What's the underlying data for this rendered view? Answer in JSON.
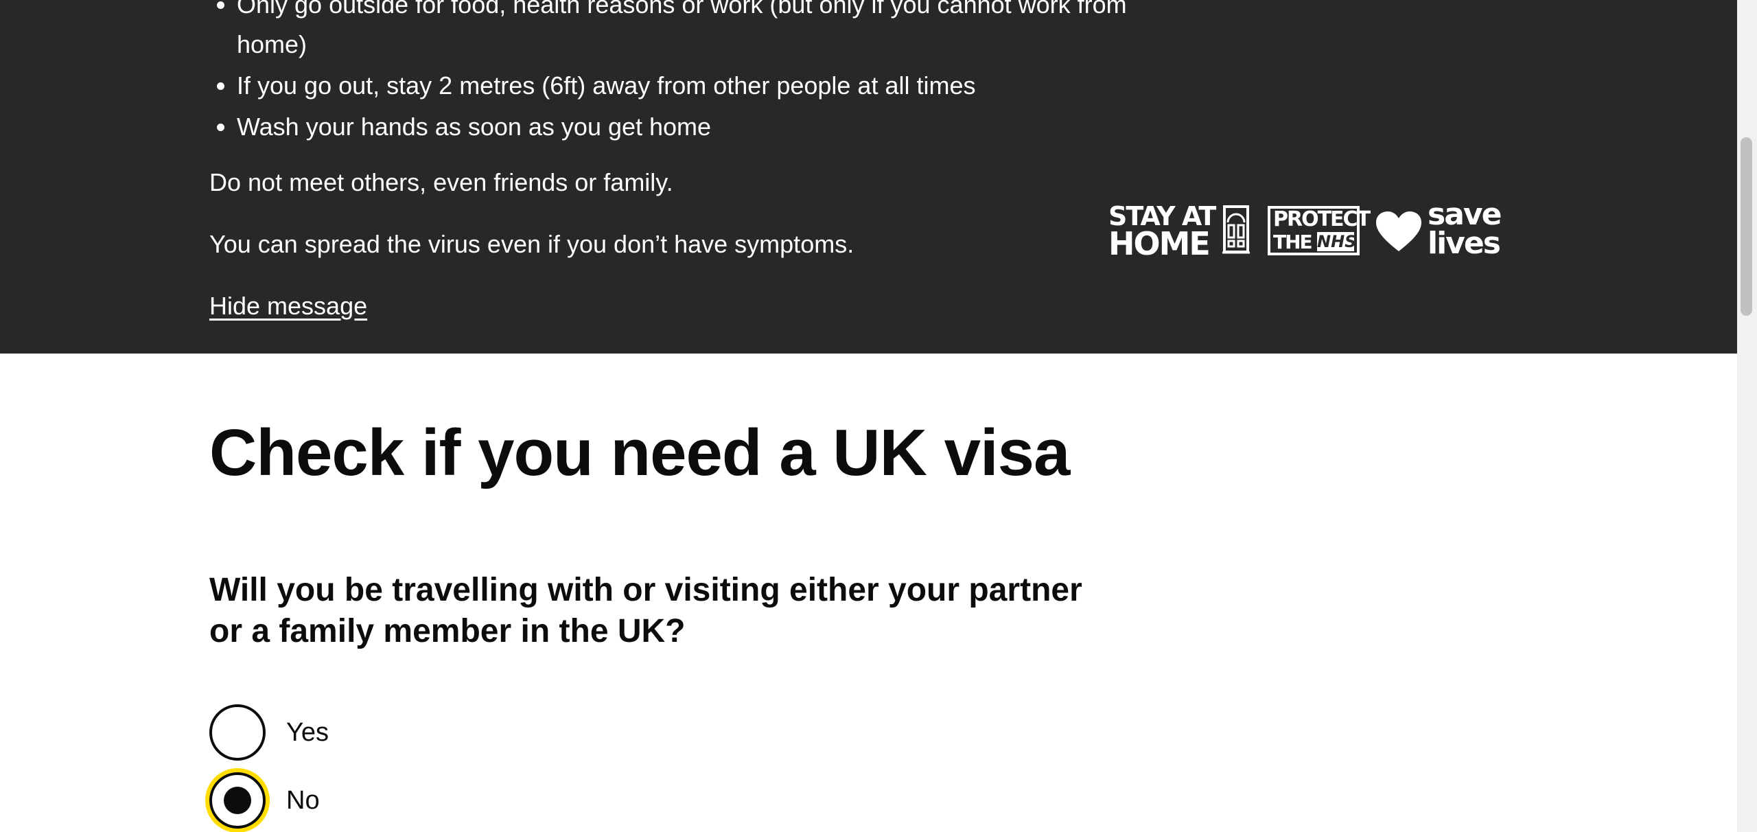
{
  "banner": {
    "bullets": [
      "Only go outside for food, health reasons or work (but only if you cannot work from home)",
      "If you go out, stay 2 metres (6ft) away from other people at all times",
      "Wash your hands as soon as you get home"
    ],
    "text1": "Do not meet others, even friends or family.",
    "text2": "You can spread the virus even if you don’t have symptoms.",
    "hide_link": "Hide message",
    "slogans": {
      "stay": "STAY AT",
      "home": "HOME",
      "protect": "PROTECT",
      "the": "THE",
      "nhs": "NHS",
      "save": "save",
      "lives": "lives"
    },
    "background": "#272828"
  },
  "page": {
    "title": "Check if you need a UK visa",
    "question": "Will you be travelling with or visiting either your partner or a family member in the UK?",
    "options": [
      {
        "label": "Yes",
        "selected": false
      },
      {
        "label": "No",
        "selected": true
      }
    ],
    "focus_color": "#ffdd00"
  }
}
